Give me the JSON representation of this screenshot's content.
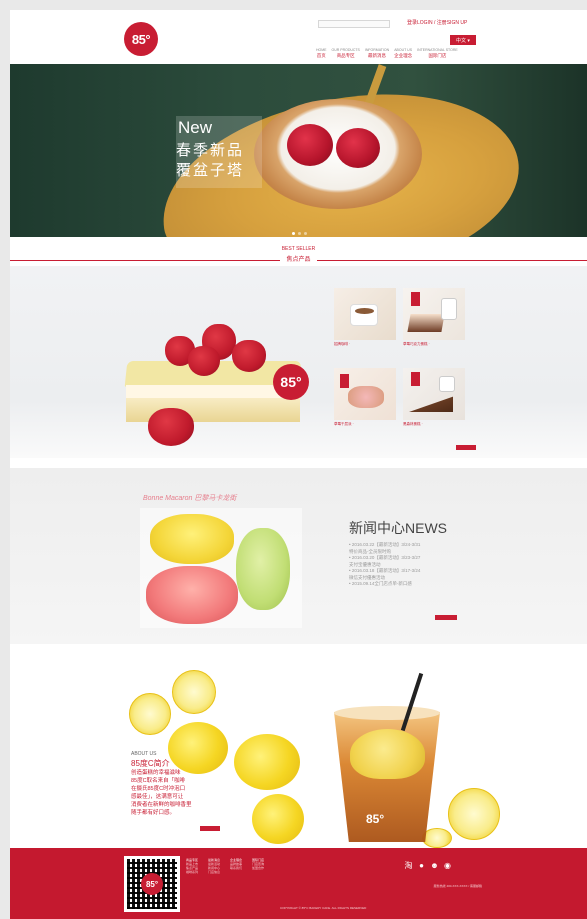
{
  "header": {
    "logo_text": "85°",
    "login": "登录LOGIN / 注册SIGN UP",
    "lang_button": "中文 ▾",
    "nav": [
      {
        "en": "HOME",
        "cn": "首页"
      },
      {
        "en": "OUR PRODUCTS",
        "cn": "商品专区"
      },
      {
        "en": "INFORMATION",
        "cn": "最新消息"
      },
      {
        "en": "ABOUT US",
        "cn": "企业理念"
      },
      {
        "en": "INTERNATIONAL STORE",
        "cn": "国际门店"
      }
    ]
  },
  "hero": {
    "tag": "New",
    "line1": "春季新品",
    "line2": "覆盆子塔"
  },
  "best_seller": {
    "title": "BEST SELLER",
    "subtitle": "焦点产品",
    "badge": "85°",
    "cards": [
      {
        "caption": "招牌咖啡 ·"
      },
      {
        "caption": "草莓巧克力蛋糕 ·"
      },
      {
        "caption": "草莓千层派 ·"
      },
      {
        "caption": "黑森林蛋糕 ·"
      }
    ]
  },
  "macaron": {
    "title": "Bonne Macaron 巴黎马卡龙街"
  },
  "news": {
    "title": "新闻中心NEWS",
    "items": [
      "• 2016.03.22【最新活动】3/24-3/31",
      "  特价商品-全员限时购",
      "• 2016.03.20【最新活动】3/23-3/27",
      "  支付宝優惠活动",
      "• 2016.03.18【最新活动】3/17-3/24",
      "  微信支付優惠活动",
      "• 2015.09.14全门店点单-新口感"
    ]
  },
  "about": {
    "en": "ABOUT US",
    "title": "85度C简介",
    "lines": [
      "创造蛋糕的幸福滋味",
      "85度C取名来自「咖啡",
      "在摄氏85度C时冲泡口",
      "感最佳」，这满意可让",
      "消费者在新鲜的咖啡香里",
      "随手都有好口感。"
    ]
  },
  "cup": {
    "logo": "85°"
  },
  "footer": {
    "qr_logo": "85°",
    "columns": [
      {
        "head": "商品专区",
        "items": [
          "新品上市",
          "焦点产品",
          "咖啡系列"
        ]
      },
      {
        "head": "最新消息",
        "items": [
          "最新活动",
          "新闻中心",
          "门店信息"
        ]
      },
      {
        "head": "企业理念",
        "items": [
          "品牌故事",
          "联系我们"
        ]
      },
      {
        "head": "国际门店",
        "items": [
          "门店查询",
          "加盟合作"
        ]
      }
    ],
    "info": "服务热线 400-XXX-XXXX / 客服邮箱",
    "copyright": "COPYRIGHT © 85°C BAKERY CAFE. ALL RIGHTS RESERVED"
  }
}
